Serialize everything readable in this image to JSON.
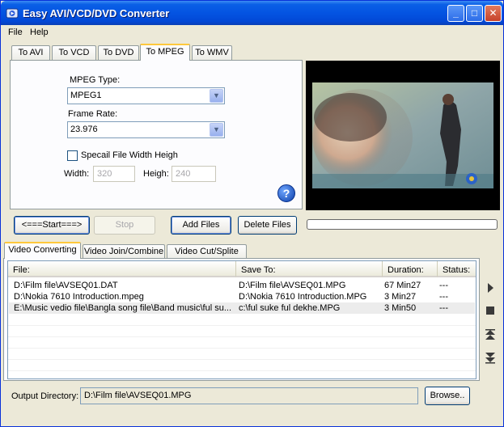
{
  "window": {
    "title": "Easy AVI/VCD/DVD Converter"
  },
  "titlebar_buttons": {
    "minimize": "_",
    "maximize": "□",
    "close": "✕"
  },
  "menu": [
    "File",
    "Help"
  ],
  "format_tabs": [
    "To AVI",
    "To  VCD",
    "To DVD",
    "To MPEG",
    "To WMV"
  ],
  "settings": {
    "mpeg_type_label": "MPEG Type:",
    "mpeg_type_value": "MPEG1",
    "frame_rate_label": "Frame Rate:",
    "frame_rate_value": "23.976",
    "special_size_label": "Specail File Width   Heigh",
    "width_label": "Width:",
    "width_value": "320",
    "height_label": "Heigh:",
    "height_value": "240",
    "help_icon": "?"
  },
  "actions": {
    "start": "<===Start===>",
    "stop": "Stop",
    "add_files": "Add Files",
    "delete_files": "Delete Files"
  },
  "progress": {
    "value": 0
  },
  "job_tabs": [
    "Video Converting",
    "Video Join/Combine",
    "Video Cut/Splite"
  ],
  "list": {
    "headers": [
      "File:",
      "Save To:",
      "Duration:",
      "Status:"
    ],
    "rows": [
      {
        "file": "D:\\Film file\\AVSEQ01.DAT",
        "save_to": "D:\\Film file\\AVSEQ01.MPG",
        "duration": "67  Min27",
        "status": "---"
      },
      {
        "file": "D:\\Nokia  7610 Introduction.mpeg",
        "save_to": "D:\\Nokia  7610 Introduction.MPG",
        "duration": "3  Min27",
        "status": "---"
      },
      {
        "file": "E:\\Music vedio file\\Bangla song file\\Band music\\ful su...",
        "save_to": "c:\\ful suke ful dekhe.MPG",
        "duration": "3  Min50",
        "status": "---"
      }
    ]
  },
  "side_controls": [
    "play-icon",
    "stop-icon",
    "move-up-icon",
    "move-down-icon"
  ],
  "output": {
    "label": "Output Directory:",
    "value": "D:\\Film file\\AVSEQ01.MPG",
    "browse": "Browse.."
  },
  "colors": {
    "title_bar": "#0454e2",
    "window_bg": "#ece9d8",
    "active_tab_highlight": "#ffc83c"
  }
}
